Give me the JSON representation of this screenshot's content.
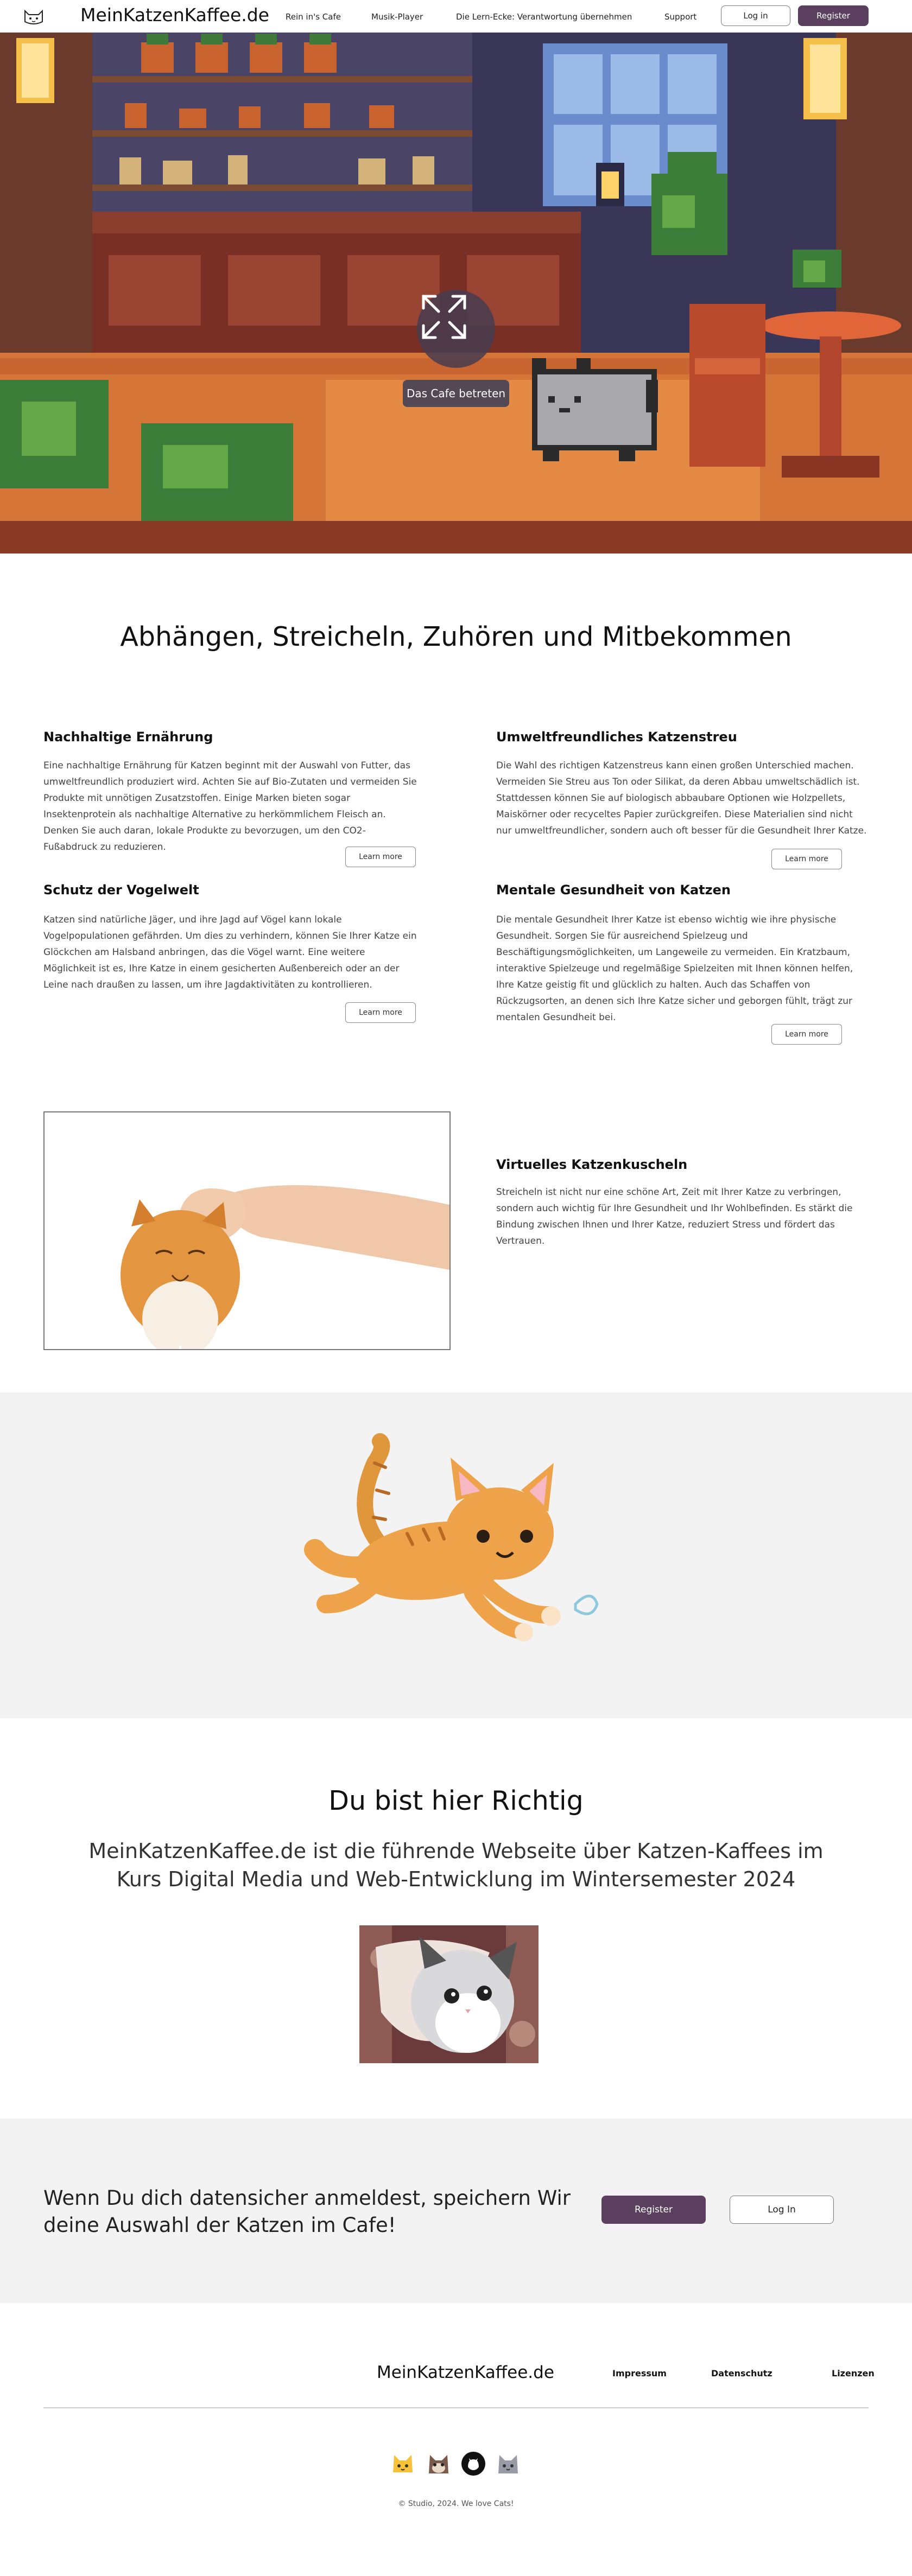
{
  "nav": {
    "brand": "MeinKatzenKaffee.de",
    "links": [
      "Rein in's Cafe",
      "Musik-Player",
      "Die Lern-Ecke: Verantwortung übernehmen",
      "Support"
    ],
    "login_label": "Log in",
    "register_label": "Register"
  },
  "hero": {
    "enter_label": "Das Cafe betreten"
  },
  "intro": {
    "title": "Abhängen, Streicheln, Zuhören und Mitbekommen",
    "features": [
      {
        "title": "Nachhaltige Ernährung",
        "text": "Eine nachhaltige Ernährung für Katzen beginnt mit der Auswahl von  Futter, das umweltfreundlich produziert wird. Achten Sie auf Bio-Zutaten und vermeiden Sie Produkte mit unnötigen Zusatzstoffen. Einige Marken  bieten sogar Insektenprotein als nachhaltige Alternative zu  herkömmlichem Fleisch an. Denken Sie auch daran, lokale Produkte zu  bevorzugen, um den CO2-Fußabdruck zu reduzieren.",
        "button": "Learn more"
      },
      {
        "title": "Umweltfreundliches Katzenstreu",
        "text": "Die Wahl des richtigen Katzenstreus kann einen großen Unterschied machen. Vermeiden Sie Streu aus Ton oder Silikat, da deren Abbau umweltschädlich ist. Stattdessen können Sie auf biologisch abbaubare Optionen wie Holzpellets, Maiskörner oder recyceltes Papier  zurückgreifen. Diese Materialien sind nicht nur umweltfreundlicher,  sondern auch oft besser für die Gesundheit Ihrer Katze.",
        "button": "Learn more"
      },
      {
        "title": "Schutz der Vogelwelt",
        "text": "Katzen sind natürliche Jäger, und ihre Jagd auf Vögel kann lokale Vogelpopulationen gefährden. Um dies zu verhindern, können Sie Ihrer  Katze ein Glöckchen am Halsband anbringen, das die Vögel warnt. Eine  weitere Möglichkeit ist es, Ihre Katze in einem gesicherten Außenbereich oder an der Leine nach draußen zu lassen, um ihre Jagdaktivitäten zu  kontrollieren.",
        "button": "Learn more"
      },
      {
        "title": "Mentale Gesundheit von Katzen",
        "text": "Die mentale Gesundheit Ihrer Katze ist ebenso wichtig wie ihre physische Gesundheit. Sorgen Sie für ausreichend Spielzeug und Beschäftigungsmöglichkeiten, um Langeweile zu vermeiden. Ein Kratzbaum, interaktive Spielzeuge und regelmäßige Spielzeiten mit Ihnen können  helfen, Ihre Katze geistig fit und glücklich zu halten. Auch das  Schaffen von Rückzugsorten, an denen sich Ihre Katze sicher und geborgen fühlt, trägt zur mentalen Gesundheit bei.",
        "button": "Learn more"
      }
    ]
  },
  "virtual": {
    "title": "Virtuelles Katzenkuscheln",
    "text": "Streicheln ist nicht nur eine schöne Art, Zeit mit Ihrer Katze zu  verbringen, sondern auch wichtig für Ihre Gesundheit und Ihr  Wohlbefinden. Es stärkt die Bindung zwischen Ihnen und Ihrer Katze,  reduziert Stress und fördert das Vertrauen."
  },
  "right_place": {
    "title": "Du bist hier Richtig",
    "subtitle": "MeinKatzenKaffee.de ist die führende Webseite über Katzen-Kaffees im Kurs Digital Media und Web-Entwicklung im Wintersemester 2024"
  },
  "signup": {
    "text": "Wenn Du dich datensicher anmeldest, speichern Wir deine Auswahl der Katzen im Cafe!",
    "register_label": "Register",
    "login_label": "Log In"
  },
  "footer": {
    "brand": "MeinKatzenKaffee.de",
    "links": [
      "Impressum",
      "Datenschutz",
      "Lizenzen"
    ],
    "icons": [
      "cat-face-icon",
      "cat-head-icon",
      "github-icon",
      "gray-cat-icon"
    ],
    "copyright": "© Studio, 2024. We love Cats!"
  },
  "colors": {
    "accent": "#5a3f5e",
    "band": "#f3f3f3"
  }
}
